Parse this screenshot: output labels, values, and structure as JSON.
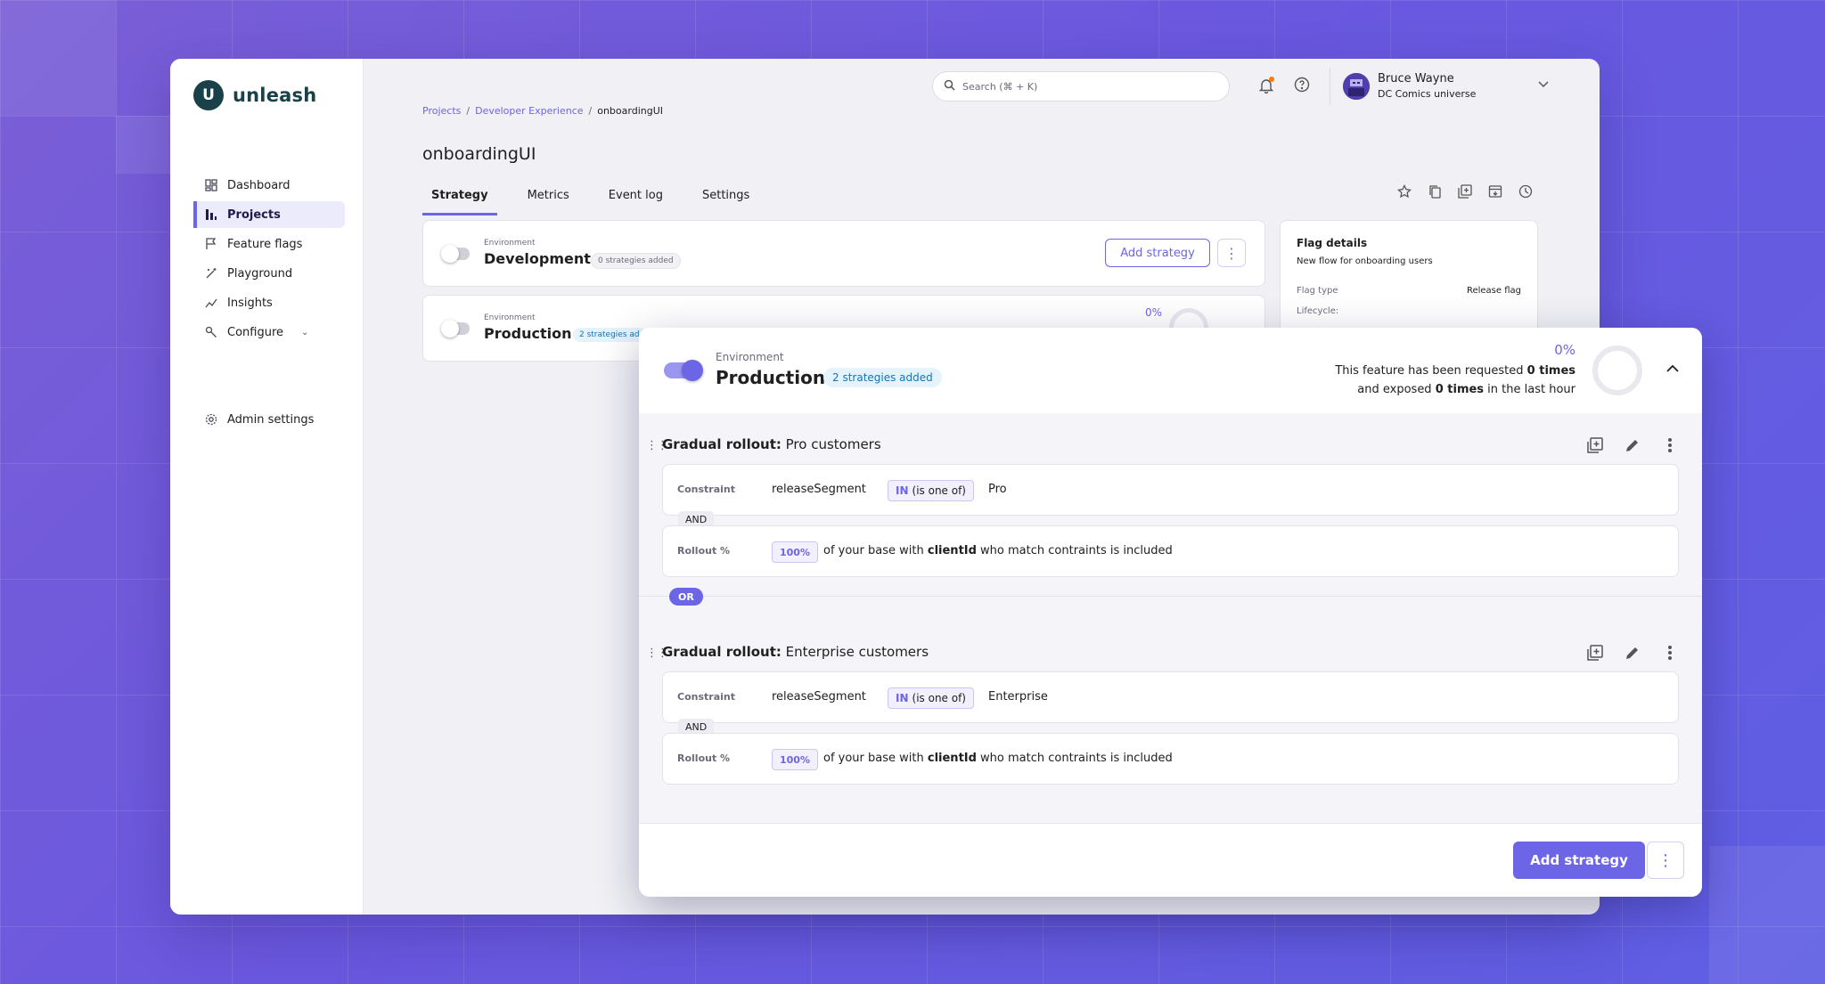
{
  "brand": {
    "logo_letter": "U",
    "name": "unleash",
    "accent": "#6c65e5",
    "dark": "#1a4049"
  },
  "sidebar": {
    "items": [
      {
        "label": "Dashboard",
        "icon": "dashboard-icon"
      },
      {
        "label": "Projects",
        "icon": "projects-icon",
        "active": true
      },
      {
        "label": "Feature flags",
        "icon": "flag-icon"
      },
      {
        "label": "Playground",
        "icon": "wand-icon"
      },
      {
        "label": "Insights",
        "icon": "chart-line-icon"
      },
      {
        "label": "Configure",
        "icon": "wrench-icon",
        "expandable": true
      }
    ],
    "admin": {
      "label": "Admin settings",
      "icon": "gear-icon"
    }
  },
  "topbar": {
    "search_placeholder": "Search (⌘ + K)",
    "user_name": "Bruce Wayne",
    "user_org": "DC Comics universe"
  },
  "breadcrumb": {
    "projects": "Projects",
    "project": "Developer Experience",
    "current": "onboardingUI"
  },
  "page": {
    "title": "onboardingUI"
  },
  "tabs": [
    "Strategy",
    "Metrics",
    "Event log",
    "Settings"
  ],
  "environments": {
    "development": {
      "label": "Environment",
      "name": "Development",
      "badge": "0 strategies added",
      "add_strategy": "Add strategy"
    },
    "production": {
      "label": "Environment",
      "name": "Production",
      "badge": "2 strategies ad",
      "percent": "0%"
    }
  },
  "flag_details": {
    "title": "Flag details",
    "description": "New flow for onboarding users",
    "type_label": "Flag type",
    "type_value": "Release flag",
    "lifecycle_label": "Lifecycle:"
  },
  "popup": {
    "env_label": "Environment",
    "env_name": "Production",
    "badge": "2 strategies added",
    "percent": "0%",
    "req_1": "This feature has been requested ",
    "req_1_bold": "0 times",
    "req_2": "and exposed ",
    "req_2_bold": "0 times",
    "req_2_end": " in the last hour",
    "strategies": [
      {
        "title_bold": "Gradual rollout:",
        "title_rest": " Pro customers",
        "constraint_label": "Constraint",
        "context": "releaseSegment",
        "operator_in": "IN",
        "operator_rest": "(is one of)",
        "value": "Pro",
        "and": "AND",
        "rollout_label": "Rollout %",
        "rollout_pct": "100%",
        "rollout_1": "of your base with ",
        "rollout_bold": "clientId",
        "rollout_2": " who match contraints is included"
      },
      {
        "title_bold": "Gradual rollout:",
        "title_rest": " Enterprise customers",
        "constraint_label": "Constraint",
        "context": "releaseSegment",
        "operator_in": "IN",
        "operator_rest": "(is one of)",
        "value": "Enterprise",
        "and": "AND",
        "rollout_label": "Rollout %",
        "rollout_pct": "100%",
        "rollout_1": "of your base with ",
        "rollout_bold": "clientId",
        "rollout_2": " who match contraints is included"
      }
    ],
    "or": "OR",
    "add_strategy": "Add strategy"
  }
}
